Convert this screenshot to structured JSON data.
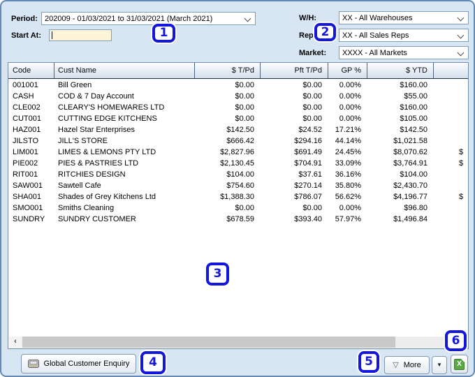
{
  "filters": {
    "period": {
      "label": "Period:",
      "value": "202009 - 01/03/2021 to 31/03/2021 (March 2021)"
    },
    "start_at": {
      "label": "Start At:",
      "value": ""
    },
    "warehouse": {
      "label": "W/H:",
      "value": "XX - All Warehouses"
    },
    "rep": {
      "label": "Rep:",
      "value": "XX - All Sales Reps"
    },
    "market": {
      "label": "Market:",
      "value": "XXXX - All Markets"
    }
  },
  "table": {
    "columns": [
      "Code",
      "Cust Name",
      "$ T/Pd",
      "Pft T/Pd",
      "GP %",
      "$ YTD",
      ""
    ],
    "rows": [
      [
        "001001",
        "Bill Green",
        "$0.00",
        "$0.00",
        "0.00%",
        "$160.00",
        ""
      ],
      [
        "CASH",
        "COD & 7 Day Account",
        "$0.00",
        "$0.00",
        "0.00%",
        "$55.00",
        ""
      ],
      [
        "CLE002",
        "CLEARY'S HOMEWARES LTD",
        "$0.00",
        "$0.00",
        "0.00%",
        "$160.00",
        ""
      ],
      [
        "CUT001",
        "CUTTING EDGE KITCHENS",
        "$0.00",
        "$0.00",
        "0.00%",
        "$105.00",
        ""
      ],
      [
        "HAZ001",
        "Hazel Star Enterprises",
        "$142.50",
        "$24.52",
        "17.21%",
        "$142.50",
        ""
      ],
      [
        "JILSTO",
        "JILL'S STORE",
        "$666.42",
        "$294.16",
        "44.14%",
        "$1,021.58",
        ""
      ],
      [
        "LIM001",
        "LIMES & LEMONS PTY LTD",
        "$2,827.96",
        "$691.49",
        "24.45%",
        "$8,070.62",
        "$"
      ],
      [
        "PIE002",
        "PIES & PASTRIES LTD",
        "$2,130.45",
        "$704.91",
        "33.09%",
        "$3,764.91",
        "$"
      ],
      [
        "RIT001",
        "RITCHIES DESIGN",
        "$104.00",
        "$37.61",
        "36.16%",
        "$104.00",
        ""
      ],
      [
        "SAW001",
        "Sawtell Cafe",
        "$754.60",
        "$270.14",
        "35.80%",
        "$2,430.70",
        ""
      ],
      [
        "SHA001",
        "Shades of Grey Kitchens Ltd",
        "$1,388.30",
        "$786.07",
        "56.62%",
        "$4,196.77",
        "$"
      ],
      [
        "SMO001",
        "Smiths Cleaning",
        "$0.00",
        "$0.00",
        "0.00%",
        "$96.80",
        ""
      ],
      [
        "SUNDRY",
        "SUNDRY CUSTOMER",
        "$678.59",
        "$393.40",
        "57.97%",
        "$1,496.84",
        ""
      ]
    ]
  },
  "scrollbar": {
    "left_arrow": "‹",
    "right_arrow": "›"
  },
  "footer": {
    "global_enquiry_label": "Global Customer Enquiry",
    "more_label": "More"
  },
  "icons": {
    "more_triangle": "▽",
    "dropdown_arrow": "▼",
    "excel_letter": "X"
  },
  "callouts": [
    "1",
    "2",
    "3",
    "4",
    "5",
    "6"
  ],
  "colors": {
    "window_background": "#d8e6f4",
    "callout_blue": "#1316dc",
    "start_at_background": "#fdf4d9",
    "excel_green": "#5ca646"
  }
}
